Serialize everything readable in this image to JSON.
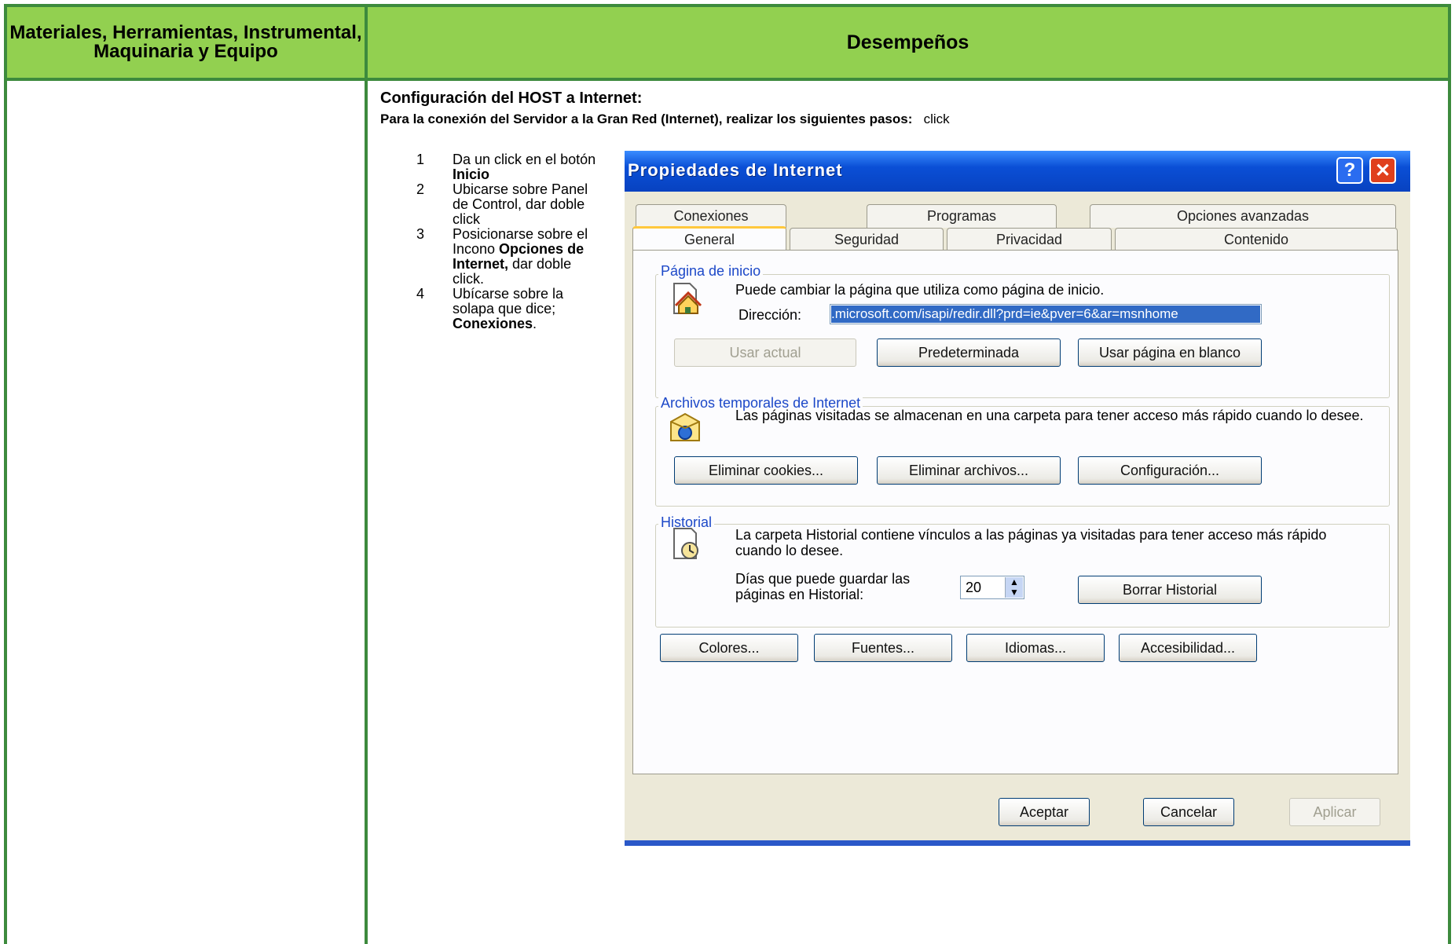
{
  "header": {
    "col1": "Materiales, Herramientas, Instrumental, Maquinaria y Equipo",
    "col2": "Desempeños"
  },
  "intro": {
    "title": "Configuración del HOST a Internet:",
    "text_bold": "Para la conexión del Servidor a la Gran Red (Internet), realizar los siguientes pasos:",
    "text_normal": "click"
  },
  "steps": [
    {
      "num": "1",
      "parts": [
        "Da un click en el botón ",
        "Inicio",
        ""
      ]
    },
    {
      "num": "2",
      "parts": [
        " Ubicarse sobre Panel de Control, dar doble click",
        "",
        ""
      ]
    },
    {
      "num": "3",
      "parts": [
        " Posicionarse sobre el Incono ",
        "Opciones de Internet,",
        " dar doble click."
      ]
    },
    {
      "num": "4",
      "parts": [
        " Ubícarse sobre la solapa que dice; ",
        "Conexiones",
        "."
      ]
    }
  ],
  "dialog": {
    "title": "Propiedades de Internet",
    "help": "?",
    "close": "✕",
    "tabs_back": [
      "Conexiones",
      "Programas",
      "Opciones avanzadas"
    ],
    "tabs_front": [
      "General",
      "Seguridad",
      "Privacidad",
      "Contenido"
    ],
    "home": {
      "label": "Página de inicio",
      "text": "Puede cambiar la página que utiliza como página de inicio.",
      "address_label": "Dirección:",
      "address_value": ".microsoft.com/isapi/redir.dll?prd=ie&pver=6&ar=msnhome",
      "btn_current": "Usar actual",
      "btn_default": "Predeterminada",
      "btn_blank": "Usar página en blanco"
    },
    "temp": {
      "label": "Archivos temporales de Internet",
      "text": "Las páginas visitadas se almacenan en una carpeta para tener acceso más rápido cuando lo desee.",
      "btn_cookies": "Eliminar cookies...",
      "btn_files": "Eliminar archivos...",
      "btn_settings": "Configuración..."
    },
    "history": {
      "label": "Historial",
      "text": "La carpeta Historial contiene vínculos a las páginas ya visitadas para tener acceso más rápido cuando lo desee.",
      "days_label": "Días que puede guardar las páginas en Historial:",
      "days_value": "20",
      "btn_clear": "Borrar Historial"
    },
    "bottom_buttons": [
      "Colores...",
      "Fuentes...",
      "Idiomas...",
      "Accesibilidad..."
    ],
    "ok": "Aceptar",
    "cancel": "Cancelar",
    "apply": "Aplicar"
  }
}
